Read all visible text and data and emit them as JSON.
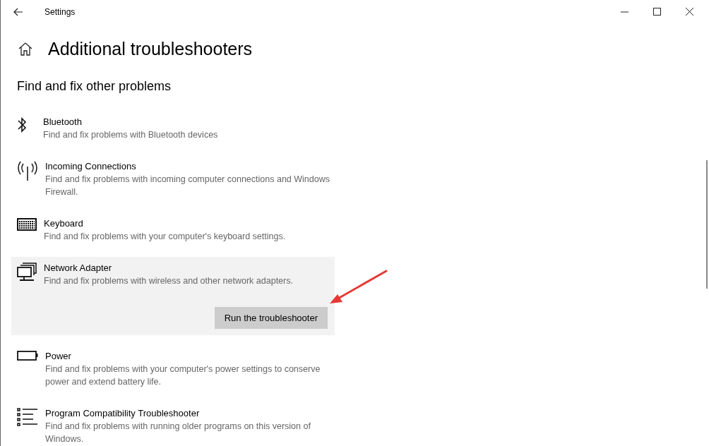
{
  "window": {
    "title": "Settings"
  },
  "page": {
    "title": "Additional troubleshooters",
    "section": "Find and fix other problems"
  },
  "items": [
    {
      "kind": "bluetooth",
      "title": "Bluetooth",
      "description": "Find and fix problems with Bluetooth devices",
      "selected": false
    },
    {
      "kind": "antenna",
      "title": "Incoming Connections",
      "description": "Find and fix problems with incoming computer connections and Windows Firewall.",
      "selected": false
    },
    {
      "kind": "keyboard",
      "title": "Keyboard",
      "description": "Find and fix problems with your computer's keyboard settings.",
      "selected": false
    },
    {
      "kind": "network",
      "title": "Network Adapter",
      "description": "Find and fix problems with wireless and other network adapters.",
      "selected": true,
      "button": "Run the troubleshooter"
    },
    {
      "kind": "battery",
      "title": "Power",
      "description": "Find and fix problems with your computer's power settings to conserve power and extend battery life.",
      "selected": false
    },
    {
      "kind": "list",
      "title": "Program Compatibility Troubleshooter",
      "description": "Find and fix problems with running older programs on this version of Windows.",
      "selected": false
    }
  ]
}
